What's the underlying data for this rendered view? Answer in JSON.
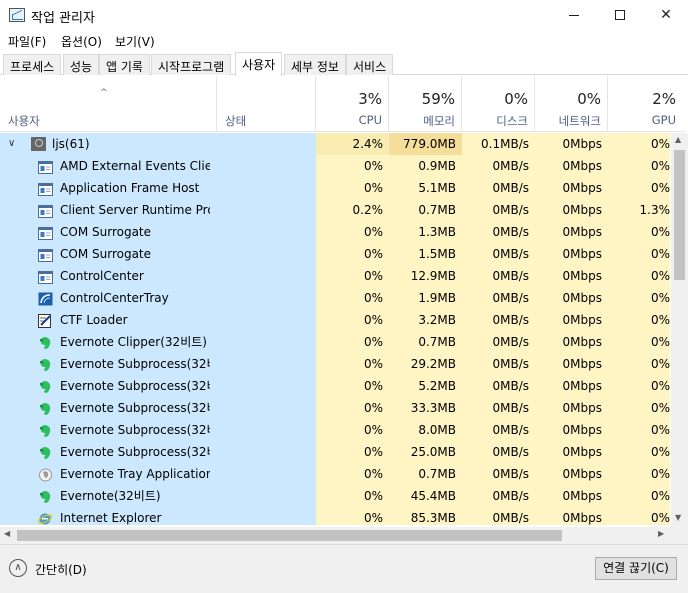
{
  "window": {
    "title": "작업 관리자",
    "minimize_label": "",
    "maximize_label": "",
    "close_label": "✕"
  },
  "menu": [
    "파일(F)",
    "옵션(O)",
    "보기(V)"
  ],
  "tabs": [
    "프로세스",
    "성능",
    "앱 기록",
    "시작프로그램",
    "사용자",
    "세부 정보",
    "서비스"
  ],
  "active_tab": "사용자",
  "header": {
    "user_col": "사용자",
    "status_col": "상태",
    "cpu": {
      "pct": "3%",
      "label": "CPU"
    },
    "mem": {
      "pct": "59%",
      "label": "메모리"
    },
    "disk": {
      "pct": "0%",
      "label": "디스크"
    },
    "net": {
      "pct": "0%",
      "label": "네트워크"
    },
    "gpu": {
      "pct": "2%",
      "label": "GPU"
    }
  },
  "user_row": {
    "name": "ljs(61)",
    "cpu": "2.4%",
    "mem": "779.0MB",
    "disk": "0.1MB/s",
    "net": "0Mbps",
    "gpu": "0%"
  },
  "processes": [
    {
      "name": "AMD External Events Clie...",
      "icon": "window-icon",
      "cpu": "0%",
      "mem": "0.9MB",
      "disk": "0MB/s",
      "net": "0Mbps",
      "gpu": "0%"
    },
    {
      "name": "Application Frame Host",
      "icon": "window-icon",
      "cpu": "0%",
      "mem": "5.1MB",
      "disk": "0MB/s",
      "net": "0Mbps",
      "gpu": "0%"
    },
    {
      "name": "Client Server Runtime Pro...",
      "icon": "window-icon",
      "cpu": "0.2%",
      "mem": "0.7MB",
      "disk": "0MB/s",
      "net": "0Mbps",
      "gpu": "1.3%"
    },
    {
      "name": "COM Surrogate",
      "icon": "window-icon",
      "cpu": "0%",
      "mem": "1.3MB",
      "disk": "0MB/s",
      "net": "0Mbps",
      "gpu": "0%"
    },
    {
      "name": "COM Surrogate",
      "icon": "window-icon",
      "cpu": "0%",
      "mem": "1.5MB",
      "disk": "0MB/s",
      "net": "0Mbps",
      "gpu": "0%"
    },
    {
      "name": "ControlCenter",
      "icon": "window-icon",
      "cpu": "0%",
      "mem": "12.9MB",
      "disk": "0MB/s",
      "net": "0Mbps",
      "gpu": "0%"
    },
    {
      "name": "ControlCenterTray",
      "icon": "control-center-icon",
      "cpu": "0%",
      "mem": "1.9MB",
      "disk": "0MB/s",
      "net": "0Mbps",
      "gpu": "0%"
    },
    {
      "name": "CTF Loader",
      "icon": "ctf-loader-icon",
      "cpu": "0%",
      "mem": "3.2MB",
      "disk": "0MB/s",
      "net": "0Mbps",
      "gpu": "0%"
    },
    {
      "name": "Evernote Clipper(32비트)",
      "icon": "evernote-icon",
      "cpu": "0%",
      "mem": "0.7MB",
      "disk": "0MB/s",
      "net": "0Mbps",
      "gpu": "0%"
    },
    {
      "name": "Evernote Subprocess(32비...",
      "icon": "evernote-icon",
      "cpu": "0%",
      "mem": "29.2MB",
      "disk": "0MB/s",
      "net": "0Mbps",
      "gpu": "0%"
    },
    {
      "name": "Evernote Subprocess(32비...",
      "icon": "evernote-icon",
      "cpu": "0%",
      "mem": "5.2MB",
      "disk": "0MB/s",
      "net": "0Mbps",
      "gpu": "0%"
    },
    {
      "name": "Evernote Subprocess(32비...",
      "icon": "evernote-icon",
      "cpu": "0%",
      "mem": "33.3MB",
      "disk": "0MB/s",
      "net": "0Mbps",
      "gpu": "0%"
    },
    {
      "name": "Evernote Subprocess(32비...",
      "icon": "evernote-icon",
      "cpu": "0%",
      "mem": "8.0MB",
      "disk": "0MB/s",
      "net": "0Mbps",
      "gpu": "0%"
    },
    {
      "name": "Evernote Subprocess(32비...",
      "icon": "evernote-icon",
      "cpu": "0%",
      "mem": "25.0MB",
      "disk": "0MB/s",
      "net": "0Mbps",
      "gpu": "0%"
    },
    {
      "name": "Evernote Tray Application(...",
      "icon": "evernote-tray-icon",
      "cpu": "0%",
      "mem": "0.7MB",
      "disk": "0MB/s",
      "net": "0Mbps",
      "gpu": "0%"
    },
    {
      "name": "Evernote(32비트)",
      "icon": "evernote-icon",
      "cpu": "0%",
      "mem": "45.4MB",
      "disk": "0MB/s",
      "net": "0Mbps",
      "gpu": "0%"
    },
    {
      "name": "Internet Explorer",
      "icon": "internet-explorer-icon",
      "cpu": "0%",
      "mem": "85.3MB",
      "disk": "0MB/s",
      "net": "0Mbps",
      "gpu": "0%"
    }
  ],
  "footer": {
    "collapse_label": "간단히(D)",
    "disconnect_label": "연결 끊기(C)"
  }
}
